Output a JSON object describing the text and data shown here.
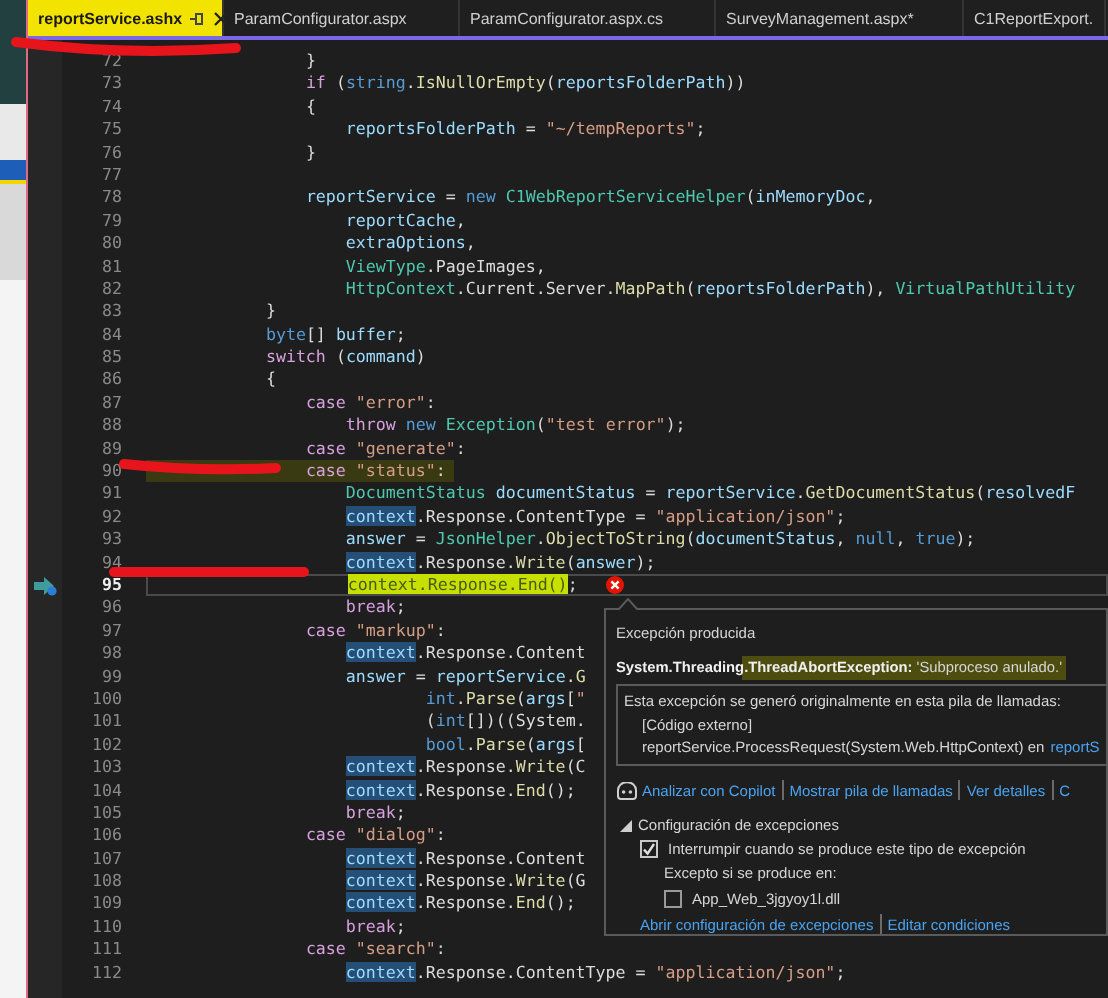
{
  "tabs": [
    {
      "label": "reportService.ashx",
      "selected": true
    },
    {
      "label": "ParamConfigurator.aspx",
      "selected": false
    },
    {
      "label": "ParamConfigurator.aspx.cs",
      "selected": false
    },
    {
      "label": "SurveyManagement.aspx*",
      "selected": false
    },
    {
      "label": "C1ReportExport.",
      "selected": false
    }
  ],
  "code_lines": [
    {
      "number": "72",
      "current": false,
      "highlighted": false,
      "tokens": [
        {
          "kind": "txt",
          "text": "                }"
        }
      ]
    },
    {
      "number": "73",
      "current": false,
      "highlighted": false,
      "tokens": [
        {
          "kind": "ctl",
          "text": "                if"
        },
        {
          "kind": "txt",
          "text": " ("
        },
        {
          "kind": "kw",
          "text": "string"
        },
        {
          "kind": "txt",
          "text": "."
        },
        {
          "kind": "fn",
          "text": "IsNullOrEmpty"
        },
        {
          "kind": "txt",
          "text": "("
        },
        {
          "kind": "var",
          "text": "reportsFolderPath"
        },
        {
          "kind": "txt",
          "text": "))"
        }
      ]
    },
    {
      "number": "74",
      "current": false,
      "highlighted": false,
      "tokens": [
        {
          "kind": "txt",
          "text": "                {"
        }
      ]
    },
    {
      "number": "75",
      "current": false,
      "highlighted": false,
      "tokens": [
        {
          "kind": "var",
          "text": "                    reportsFolderPath"
        },
        {
          "kind": "txt",
          "text": " = "
        },
        {
          "kind": "str",
          "text": "\"~/tempReports\""
        },
        {
          "kind": "txt",
          "text": ";"
        }
      ]
    },
    {
      "number": "76",
      "current": false,
      "highlighted": false,
      "tokens": [
        {
          "kind": "txt",
          "text": "                }"
        }
      ]
    },
    {
      "number": "77",
      "current": false,
      "highlighted": false
    },
    {
      "number": "78",
      "current": false,
      "highlighted": false,
      "tokens": [
        {
          "kind": "var",
          "text": "                reportService"
        },
        {
          "kind": "txt",
          "text": " = "
        },
        {
          "kind": "kw",
          "text": "new"
        },
        {
          "kind": "type",
          "text": " C1WebReportServiceHelper"
        },
        {
          "kind": "txt",
          "text": "("
        },
        {
          "kind": "var",
          "text": "inMemoryDoc"
        },
        {
          "kind": "txt",
          "text": ","
        }
      ]
    },
    {
      "number": "79",
      "current": false,
      "highlighted": false,
      "tokens": [
        {
          "kind": "var",
          "text": "                    reportCache"
        },
        {
          "kind": "txt",
          "text": ","
        }
      ]
    },
    {
      "number": "80",
      "current": false,
      "highlighted": false,
      "tokens": [
        {
          "kind": "var",
          "text": "                    extraOptions"
        },
        {
          "kind": "txt",
          "text": ","
        }
      ]
    },
    {
      "number": "81",
      "current": false,
      "highlighted": false,
      "tokens": [
        {
          "kind": "type",
          "text": "                    ViewType"
        },
        {
          "kind": "txt",
          "text": ".PageImages,"
        }
      ]
    },
    {
      "number": "82",
      "current": false,
      "highlighted": false,
      "tokens": [
        {
          "kind": "type",
          "text": "                    HttpContext"
        },
        {
          "kind": "txt",
          "text": ".Current.Server."
        },
        {
          "kind": "fn",
          "text": "MapPath"
        },
        {
          "kind": "txt",
          "text": "("
        },
        {
          "kind": "var",
          "text": "reportsFolderPath"
        },
        {
          "kind": "txt",
          "text": "), "
        },
        {
          "kind": "type",
          "text": "VirtualPathUtility"
        }
      ]
    },
    {
      "number": "83",
      "current": false,
      "highlighted": false,
      "tokens": [
        {
          "kind": "txt",
          "text": "            }"
        }
      ]
    },
    {
      "number": "84",
      "current": false,
      "highlighted": false,
      "tokens": [
        {
          "kind": "kw",
          "text": "            byte"
        },
        {
          "kind": "txt",
          "text": "[] "
        },
        {
          "kind": "var",
          "text": "buffer"
        },
        {
          "kind": "txt",
          "text": ";"
        }
      ]
    },
    {
      "number": "85",
      "current": false,
      "highlighted": false,
      "tokens": [
        {
          "kind": "ctl",
          "text": "            switch"
        },
        {
          "kind": "txt",
          "text": " ("
        },
        {
          "kind": "var",
          "text": "command"
        },
        {
          "kind": "txt",
          "text": ")"
        }
      ]
    },
    {
      "number": "86",
      "current": false,
      "highlighted": false,
      "tokens": [
        {
          "kind": "txt",
          "text": "            {"
        }
      ]
    },
    {
      "number": "87",
      "current": false,
      "highlighted": false,
      "tokens": [
        {
          "kind": "ctl",
          "text": "                case"
        },
        {
          "kind": "str",
          "text": " \"error\""
        },
        {
          "kind": "txt",
          "text": ":"
        }
      ]
    },
    {
      "number": "88",
      "current": false,
      "highlighted": false,
      "tokens": [
        {
          "kind": "ctl",
          "text": "                    throw"
        },
        {
          "kind": "kw",
          "text": " new"
        },
        {
          "kind": "type",
          "text": " Exception"
        },
        {
          "kind": "txt",
          "text": "("
        },
        {
          "kind": "str",
          "text": "\"test error\""
        },
        {
          "kind": "txt",
          "text": ");"
        }
      ]
    },
    {
      "number": "89",
      "current": false,
      "highlighted": false,
      "tokens": [
        {
          "kind": "ctl",
          "text": "                case"
        },
        {
          "kind": "str",
          "text": " \"generate\""
        },
        {
          "kind": "txt",
          "text": ":"
        }
      ]
    },
    {
      "number": "90",
      "current": false,
      "highlighted": true,
      "tokens": [
        {
          "kind": "ctl",
          "text": "                case"
        },
        {
          "kind": "str",
          "text": " \"status\""
        },
        {
          "kind": "txt",
          "text": ":"
        }
      ]
    },
    {
      "number": "91",
      "current": false,
      "highlighted": false,
      "tokens": [
        {
          "kind": "type",
          "text": "                    DocumentStatus"
        },
        {
          "kind": "var",
          "text": " documentStatus"
        },
        {
          "kind": "txt",
          "text": " = "
        },
        {
          "kind": "var",
          "text": "reportService"
        },
        {
          "kind": "txt",
          "text": "."
        },
        {
          "kind": "fn",
          "text": "GetDocumentStatus"
        },
        {
          "kind": "txt",
          "text": "("
        },
        {
          "kind": "var",
          "text": "resolvedF"
        }
      ]
    },
    {
      "number": "92",
      "current": false,
      "highlighted": false,
      "tokens": [
        {
          "kind": "ref",
          "text": "                    context"
        },
        {
          "kind": "txt",
          "text": ".Response.ContentType = "
        },
        {
          "kind": "str",
          "text": "\"application/json\""
        },
        {
          "kind": "txt",
          "text": ";"
        }
      ]
    },
    {
      "number": "93",
      "current": false,
      "highlighted": false,
      "tokens": [
        {
          "kind": "var",
          "text": "                    answer"
        },
        {
          "kind": "txt",
          "text": " = "
        },
        {
          "kind": "type",
          "text": "JsonHelper"
        },
        {
          "kind": "txt",
          "text": "."
        },
        {
          "kind": "fn",
          "text": "ObjectToString"
        },
        {
          "kind": "txt",
          "text": "("
        },
        {
          "kind": "var",
          "text": "documentStatus"
        },
        {
          "kind": "txt",
          "text": ", "
        },
        {
          "kind": "kw",
          "text": "null"
        },
        {
          "kind": "txt",
          "text": ", "
        },
        {
          "kind": "kw",
          "text": "true"
        },
        {
          "kind": "txt",
          "text": ");"
        }
      ]
    },
    {
      "number": "94",
      "current": false,
      "highlighted": false,
      "tokens": [
        {
          "kind": "ref",
          "text": "                    context"
        },
        {
          "kind": "txt",
          "text": ".Response."
        },
        {
          "kind": "fn",
          "text": "Write"
        },
        {
          "kind": "txt",
          "text": "("
        },
        {
          "kind": "var",
          "text": "answer"
        },
        {
          "kind": "txt",
          "text": ");"
        }
      ]
    },
    {
      "number": "95",
      "current": true,
      "highlighted": false,
      "tokens": [
        {
          "kind": "exec",
          "text": "                    context.Response.End()"
        },
        {
          "kind": "txt",
          "text": ";"
        }
      ]
    },
    {
      "number": "96",
      "current": false,
      "highlighted": false,
      "tokens": [
        {
          "kind": "ctl",
          "text": "                    break"
        },
        {
          "kind": "txt",
          "text": ";"
        }
      ]
    },
    {
      "number": "97",
      "current": false,
      "highlighted": false,
      "tokens": [
        {
          "kind": "ctl",
          "text": "                case"
        },
        {
          "kind": "str",
          "text": " \"markup\""
        },
        {
          "kind": "txt",
          "text": ":"
        }
      ]
    },
    {
      "number": "98",
      "current": false,
      "highlighted": false,
      "tokens": [
        {
          "kind": "ref",
          "text": "                    context"
        },
        {
          "kind": "txt",
          "text": ".Response.Content"
        }
      ]
    },
    {
      "number": "99",
      "current": false,
      "highlighted": false,
      "tokens": [
        {
          "kind": "var",
          "text": "                    answer"
        },
        {
          "kind": "txt",
          "text": " = "
        },
        {
          "kind": "var",
          "text": "reportService"
        },
        {
          "kind": "txt",
          "text": "."
        },
        {
          "kind": "fn",
          "text": "G"
        }
      ]
    },
    {
      "number": "100",
      "current": false,
      "highlighted": false,
      "tokens": [
        {
          "kind": "kw",
          "text": "                            int"
        },
        {
          "kind": "txt",
          "text": "."
        },
        {
          "kind": "fn",
          "text": "Parse"
        },
        {
          "kind": "txt",
          "text": "("
        },
        {
          "kind": "var",
          "text": "args"
        },
        {
          "kind": "txt",
          "text": "["
        },
        {
          "kind": "str",
          "text": "\""
        }
      ]
    },
    {
      "number": "101",
      "current": false,
      "highlighted": false,
      "tokens": [
        {
          "kind": "txt",
          "text": "                            ("
        },
        {
          "kind": "kw",
          "text": "int"
        },
        {
          "kind": "txt",
          "text": "[])((System."
        }
      ]
    },
    {
      "number": "102",
      "current": false,
      "highlighted": false,
      "tokens": [
        {
          "kind": "kw",
          "text": "                            bool"
        },
        {
          "kind": "txt",
          "text": "."
        },
        {
          "kind": "fn",
          "text": "Parse"
        },
        {
          "kind": "txt",
          "text": "("
        },
        {
          "kind": "var",
          "text": "args"
        },
        {
          "kind": "txt",
          "text": "["
        }
      ]
    },
    {
      "number": "103",
      "current": false,
      "highlighted": false,
      "tokens": [
        {
          "kind": "ref",
          "text": "                    context"
        },
        {
          "kind": "txt",
          "text": ".Response."
        },
        {
          "kind": "fn",
          "text": "Write"
        },
        {
          "kind": "txt",
          "text": "(C"
        }
      ]
    },
    {
      "number": "104",
      "current": false,
      "highlighted": false,
      "tokens": [
        {
          "kind": "ref",
          "text": "                    context"
        },
        {
          "kind": "txt",
          "text": ".Response."
        },
        {
          "kind": "fn",
          "text": "End"
        },
        {
          "kind": "txt",
          "text": "();"
        }
      ]
    },
    {
      "number": "105",
      "current": false,
      "highlighted": false,
      "tokens": [
        {
          "kind": "ctl",
          "text": "                    break"
        },
        {
          "kind": "txt",
          "text": ";"
        }
      ]
    },
    {
      "number": "106",
      "current": false,
      "highlighted": false,
      "tokens": [
        {
          "kind": "ctl",
          "text": "                case"
        },
        {
          "kind": "str",
          "text": " \"dialog\""
        },
        {
          "kind": "txt",
          "text": ":"
        }
      ]
    },
    {
      "number": "107",
      "current": false,
      "highlighted": false,
      "tokens": [
        {
          "kind": "ref",
          "text": "                    context"
        },
        {
          "kind": "txt",
          "text": ".Response.Content"
        }
      ]
    },
    {
      "number": "108",
      "current": false,
      "highlighted": false,
      "tokens": [
        {
          "kind": "ref",
          "text": "                    context"
        },
        {
          "kind": "txt",
          "text": ".Response."
        },
        {
          "kind": "fn",
          "text": "Write"
        },
        {
          "kind": "txt",
          "text": "(G"
        }
      ]
    },
    {
      "number": "109",
      "current": false,
      "highlighted": false,
      "tokens": [
        {
          "kind": "ref",
          "text": "                    context"
        },
        {
          "kind": "txt",
          "text": ".Response."
        },
        {
          "kind": "fn",
          "text": "End"
        },
        {
          "kind": "txt",
          "text": "();"
        }
      ]
    },
    {
      "number": "110",
      "current": false,
      "highlighted": false,
      "tokens": [
        {
          "kind": "ctl",
          "text": "                    break"
        },
        {
          "kind": "txt",
          "text": ";"
        }
      ]
    },
    {
      "number": "111",
      "current": false,
      "highlighted": false,
      "tokens": [
        {
          "kind": "ctl",
          "text": "                case"
        },
        {
          "kind": "str",
          "text": " \"search\""
        },
        {
          "kind": "txt",
          "text": ":"
        }
      ]
    },
    {
      "number": "112",
      "current": false,
      "highlighted": false,
      "tokens": [
        {
          "kind": "ref",
          "text": "                    context"
        },
        {
          "kind": "txt",
          "text": ".Response.ContentType = "
        },
        {
          "kind": "str",
          "text": "\"application/json\""
        },
        {
          "kind": "txt",
          "text": ";"
        }
      ]
    }
  ],
  "exception_popup": {
    "title": "Excepción producida",
    "exception": "**System.Threading.ThreadAbortException:** 'Subproceso anulado.'",
    "stack_intro": "Esta excepción se generó originalmente en esta pila de llamadas:",
    "stack_frames": [
      {
        "text": "[Código externo]"
      },
      {
        "text": "reportService.ProcessRequest(System.Web.HttpContext) en",
        "link": "reportS"
      }
    ],
    "actions": [
      {
        "label": "Analizar con Copilot",
        "kind": "copilot"
      },
      {
        "label": "Mostrar pila de llamadas",
        "kind": "plain"
      },
      {
        "label": "Ver detalles",
        "kind": "plain"
      },
      {
        "label": "C",
        "kind": "plain"
      }
    ],
    "settings": {
      "title": "Configuración de excepciones",
      "expanded": true,
      "break_option": {
        "label": "Interrumpir cuando se produce este tipo de excepción",
        "checked": true
      },
      "except_label": "Excepto si se produce en:",
      "modules": [
        {
          "label": "App_Web_3jgyoy1l.dll",
          "checked": false
        }
      ],
      "links": [
        "Abrir configuración de excepciones",
        "Editar condiciones"
      ]
    }
  }
}
